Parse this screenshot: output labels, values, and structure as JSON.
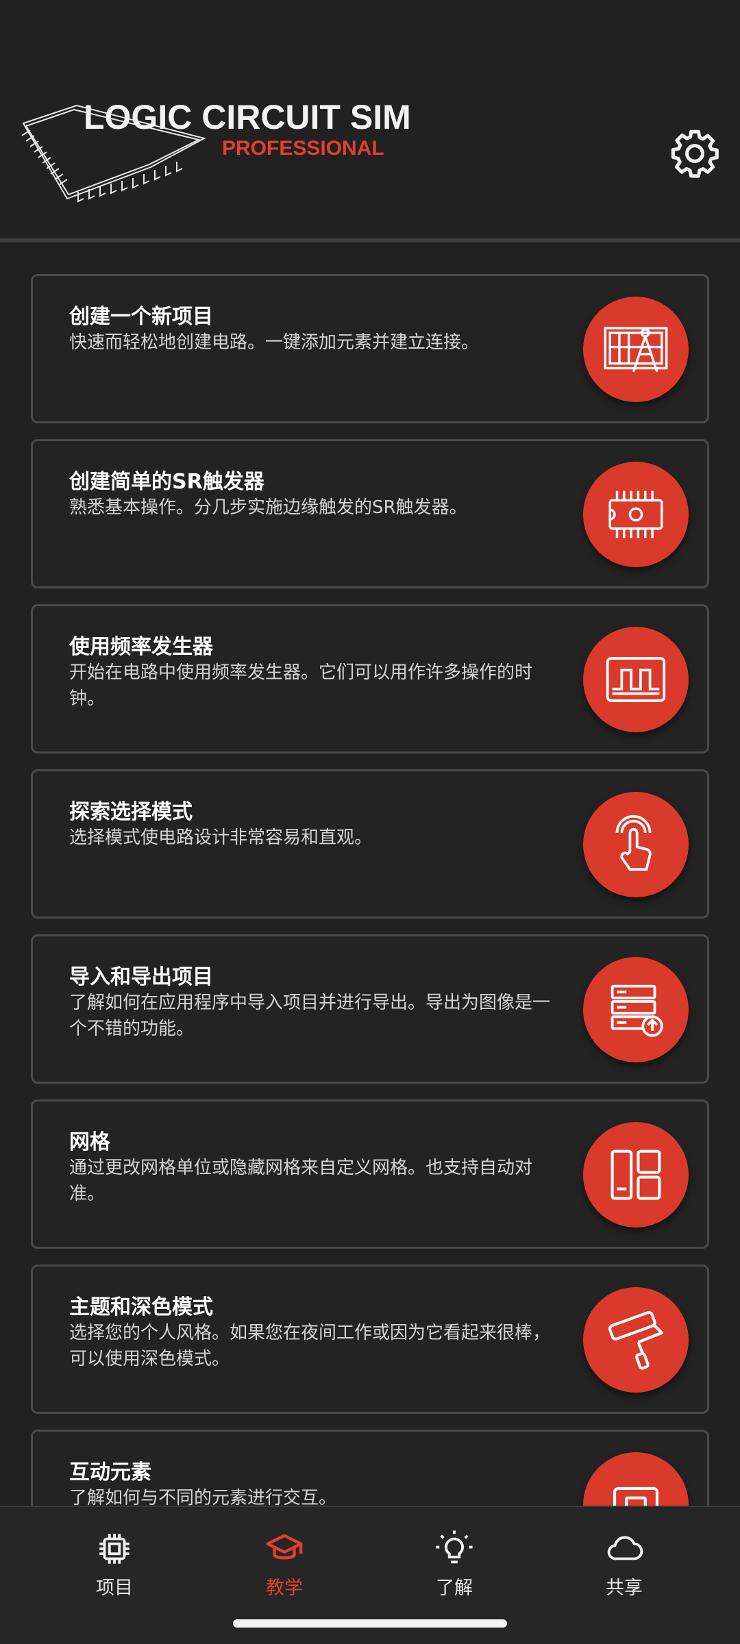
{
  "app": {
    "title": "LOGIC CIRCUIT SIM",
    "subtitle": "PROFESSIONAL"
  },
  "colors": {
    "accent": "#d93a2b",
    "background": "#212121",
    "card_border": "#4a4a4a"
  },
  "tutorials": [
    {
      "title": "创建一个新项目",
      "desc": "快速而轻松地创建电路。一键添加元素并建立连接。",
      "icon": "blueprint-compass-icon"
    },
    {
      "title": "创建简单的SR触发器",
      "desc": "熟悉基本操作。分几步实施边缘触发的SR触发器。",
      "icon": "chip-icon"
    },
    {
      "title": "使用频率发生器",
      "desc": "开始在电路中使用频率发生器。它们可以用作许多操作的时钟。",
      "icon": "square-wave-icon"
    },
    {
      "title": "探索选择模式",
      "desc": "选择模式使电路设计非常容易和直观。",
      "icon": "tap-hand-icon"
    },
    {
      "title": "导入和导出项目",
      "desc": "了解如何在应用程序中导入项目并进行导出。导出为图像是一个不错的功能。",
      "icon": "server-upload-icon"
    },
    {
      "title": "网格",
      "desc": "通过更改网格单位或隐藏网格来自定义网格。也支持自动对准。",
      "icon": "grid-layout-icon"
    },
    {
      "title": "主题和深色模式",
      "desc": "选择您的个人风格。如果您在夜间工作或因为它看起来很棒，可以使用深色模式。",
      "icon": "paint-roller-icon"
    },
    {
      "title": "互动元素",
      "desc": "了解如何与不同的元素进行交互。",
      "icon": "button-element-icon"
    }
  ],
  "nav": {
    "items": [
      {
        "label": "项目",
        "icon": "chip-icon",
        "active": false
      },
      {
        "label": "教学",
        "icon": "graduation-cap-icon",
        "active": true
      },
      {
        "label": "了解",
        "icon": "lightbulb-icon",
        "active": false
      },
      {
        "label": "共享",
        "icon": "cloud-icon",
        "active": false
      }
    ]
  }
}
